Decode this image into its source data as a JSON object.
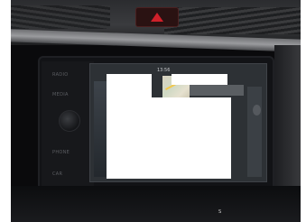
{
  "scene": {
    "left_panel_labels": [
      "RADIO",
      "MEDIA",
      "PHONE",
      "CAR"
    ],
    "screen_time": "13:56",
    "console_text": "S"
  }
}
